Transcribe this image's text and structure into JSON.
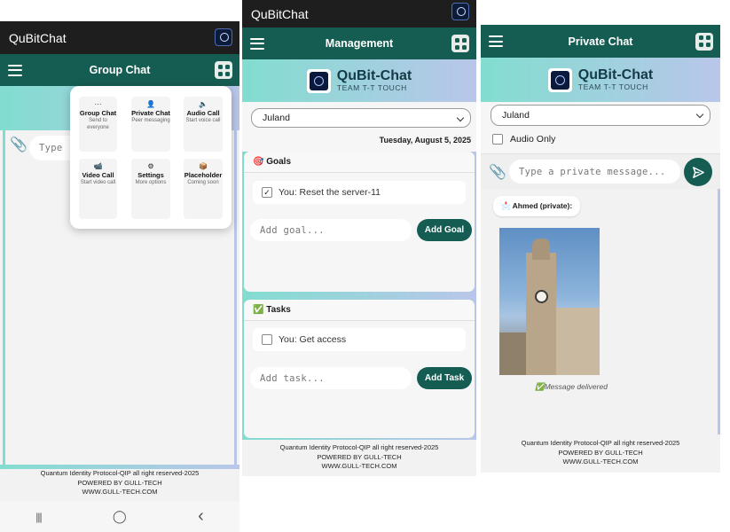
{
  "app_title": "QuBitChat",
  "brand": {
    "name": "QuBit-Chat",
    "subtitle": "TEAM T-T TOUCH"
  },
  "footer": {
    "line1": "Quantum Identity Protocol-QIP all right reserved-2025",
    "line2": "POWERED BY GULL-TECH",
    "line3": "WWW.GULL-TECH.COM"
  },
  "colors": {
    "primary": "#155d52",
    "statusbar": "#1e1e1e",
    "gradient_start": "#82ddd0",
    "gradient_end": "#b9c6ea"
  },
  "group_chat": {
    "title": "Group Chat",
    "input_placeholder": "Type",
    "attach_icon": "paperclip-icon",
    "menu": [
      {
        "icon": "chat-bubble-icon",
        "glyph": "···",
        "title": "Group Chat",
        "desc": "Send to everyone"
      },
      {
        "icon": "person-icon",
        "glyph": "👤",
        "title": "Private Chat",
        "desc": "Peer messaging"
      },
      {
        "icon": "speaker-icon",
        "glyph": "🔈",
        "title": "Audio Call",
        "desc": "Start voice call"
      },
      {
        "icon": "video-camera-icon",
        "glyph": "📹",
        "title": "Video Call",
        "desc": "Start video call"
      },
      {
        "icon": "gear-icon",
        "glyph": "⚙",
        "title": "Settings",
        "desc": "More options"
      },
      {
        "icon": "box-icon",
        "glyph": "📦",
        "title": "Placeholder",
        "desc": "Coming soon"
      }
    ],
    "nav": {
      "recent": "|||",
      "home": "◯",
      "back": "‹"
    }
  },
  "management": {
    "title": "Management",
    "selected_user": "Juland",
    "date": "Tuesday, August 5, 2025",
    "goals": {
      "heading": "🎯 Goals",
      "items": [
        {
          "text": "You: Reset the server-11",
          "checked": true
        }
      ],
      "input_placeholder": "Add goal...",
      "button": "Add Goal"
    },
    "tasks": {
      "heading": "✅ Tasks",
      "items": [
        {
          "text": "You: Get access",
          "checked": false
        }
      ],
      "input_placeholder": "Add task...",
      "button": "Add Task"
    }
  },
  "private_chat": {
    "title": "Private Chat",
    "selected_user": "Juland",
    "audio_only_label": "Audio Only",
    "audio_only_checked": false,
    "input_placeholder": "Type a private message...",
    "message": {
      "sender": "📩 Ahmed (private):",
      "image_alt": "clock tower photo",
      "status": "✅Message delivered"
    }
  }
}
